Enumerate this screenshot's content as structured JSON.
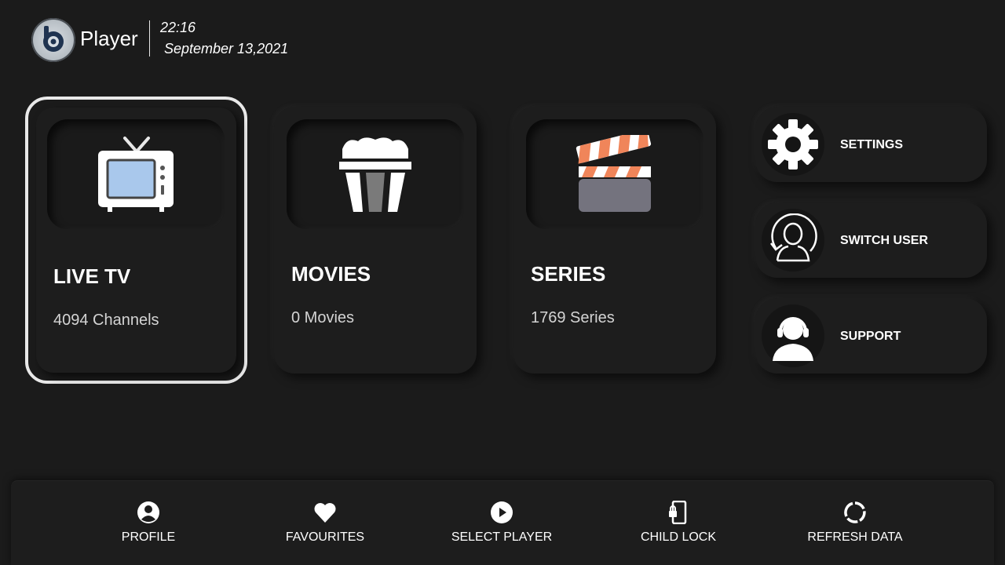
{
  "header": {
    "app_name": "Player",
    "time": "22:16",
    "date": "September 13,2021",
    "logo_icon": "b-player-logo"
  },
  "cards": [
    {
      "title": "LIVE TV",
      "count": "4094 Channels",
      "icon": "tv-icon",
      "selected": true
    },
    {
      "title": "MOVIES",
      "count": "0 Movies",
      "icon": "popcorn-icon",
      "selected": false
    },
    {
      "title": "SERIES",
      "count": "1769 Series",
      "icon": "clapperboard-icon",
      "selected": false
    }
  ],
  "side_buttons": [
    {
      "label": "SETTINGS",
      "icon": "gear-icon"
    },
    {
      "label": "SWITCH USER",
      "icon": "switch-user-icon"
    },
    {
      "label": "SUPPORT",
      "icon": "headset-support-icon"
    }
  ],
  "bottom_nav": [
    {
      "label": "PROFILE",
      "icon": "profile-icon"
    },
    {
      "label": "FAVOURITES",
      "icon": "heart-icon"
    },
    {
      "label": "SELECT PLAYER",
      "icon": "play-circle-icon"
    },
    {
      "label": "CHILD LOCK",
      "icon": "phone-lock-icon"
    },
    {
      "label": "REFRESH DATA",
      "icon": "refresh-icon"
    }
  ],
  "colors": {
    "background": "#1b1b1b",
    "card": "#1d1d1d",
    "selected_border": "#e9e9e9",
    "clapper_accent": "#f0855a",
    "tv_screen": "#a9c8ec"
  }
}
